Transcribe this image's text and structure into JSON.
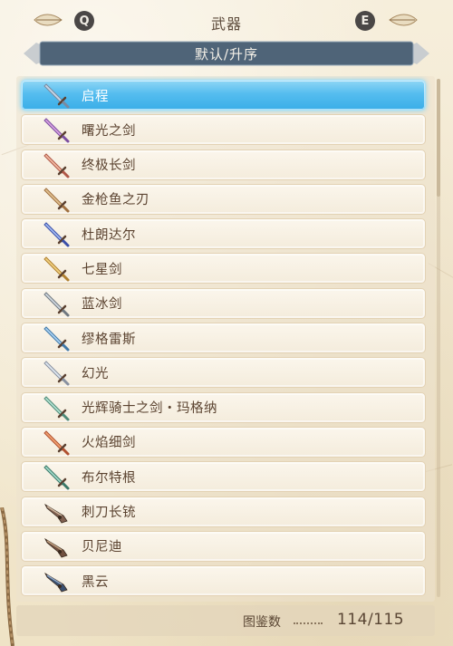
{
  "header": {
    "title": "武器",
    "prev_key": "Q",
    "next_key": "E"
  },
  "sort": {
    "label": "默认/升序"
  },
  "weapons": [
    {
      "name": "启程",
      "icon": "sword-icon",
      "selected": true
    },
    {
      "name": "曙光之剑",
      "icon": "sword-icon",
      "selected": false
    },
    {
      "name": "终极长剑",
      "icon": "sword-icon",
      "selected": false
    },
    {
      "name": "金枪鱼之刃",
      "icon": "sword-icon",
      "selected": false
    },
    {
      "name": "杜朗达尔",
      "icon": "sword-icon",
      "selected": false
    },
    {
      "name": "七星剑",
      "icon": "sword-icon",
      "selected": false
    },
    {
      "name": "蓝冰剑",
      "icon": "sword-icon",
      "selected": false
    },
    {
      "name": "缪格雷斯",
      "icon": "sword-icon",
      "selected": false
    },
    {
      "name": "幻光",
      "icon": "sword-icon",
      "selected": false
    },
    {
      "name": "光辉骑士之剑・玛格纳",
      "icon": "sword-icon",
      "selected": false
    },
    {
      "name": "火焰细剑",
      "icon": "sword-icon",
      "selected": false
    },
    {
      "name": "布尔特根",
      "icon": "sword-icon",
      "selected": false
    },
    {
      "name": "刺刀长铳",
      "icon": "gun-icon",
      "selected": false
    },
    {
      "name": "贝尼迪",
      "icon": "gun-icon",
      "selected": false
    },
    {
      "name": "黑云",
      "icon": "gun-icon",
      "selected": false
    }
  ],
  "footer": {
    "label": "图鉴数",
    "count": "114/115"
  },
  "colors": {
    "selected": "#4bb8ee",
    "sort_bar": "#4f6478",
    "text": "#5b4330"
  }
}
